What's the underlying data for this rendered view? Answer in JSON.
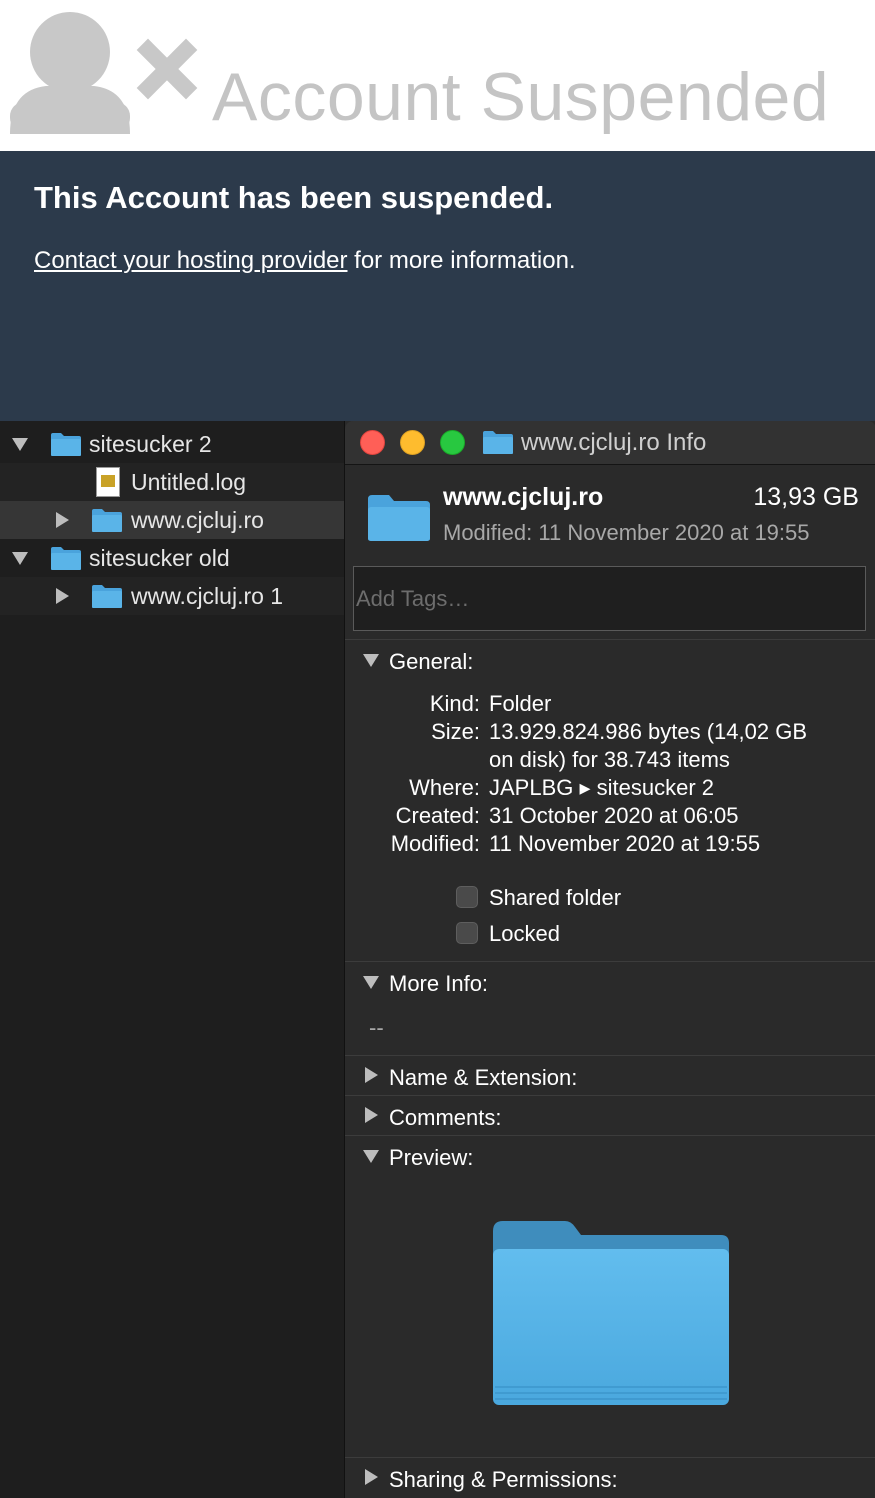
{
  "suspended": {
    "title": "Account Suspended",
    "heading": "This Account has been suspended.",
    "contact_link": "Contact your hosting provider",
    "contact_rest": " for more information.",
    "icon": "user-x-icon"
  },
  "finder": {
    "rows": [
      {
        "label": "sitesucker 2",
        "disclosure": "expanded",
        "icon": "folder-icon"
      },
      {
        "label": "Untitled.log",
        "disclosure": "none",
        "icon": "log-file-icon"
      },
      {
        "label": "www.cjcluj.ro",
        "disclosure": "collapsed",
        "icon": "folder-icon",
        "selected": true
      },
      {
        "label": "sitesucker old",
        "disclosure": "expanded",
        "icon": "folder-icon"
      },
      {
        "label": "www.cjcluj.ro 1",
        "disclosure": "collapsed",
        "icon": "folder-icon"
      }
    ]
  },
  "info_window": {
    "title": "www.cjcluj.ro Info",
    "name": "www.cjcluj.ro",
    "size": "13,93 GB",
    "modified": "Modified:  11 November 2020 at 19:55",
    "tags_placeholder": "Add Tags…",
    "sections": {
      "general": "General:",
      "more_info": "More Info:",
      "name_extension": "Name & Extension:",
      "comments": "Comments:",
      "preview": "Preview:",
      "sharing": "Sharing & Permissions:"
    },
    "general": {
      "kind_label": "Kind:",
      "kind_value": "Folder",
      "size_label": "Size:",
      "size_value_line1": "13.929.824.986 bytes (14,02 GB",
      "size_value_line2": "on disk) for 38.743 items",
      "where_label": "Where:",
      "where_value": "JAPLBG ▸ sitesucker 2",
      "created_label": "Created:",
      "created_value": "31 October 2020 at 06:05",
      "modified_label": "Modified:",
      "modified_value": "11 November 2020 at 19:55",
      "shared_folder": "Shared folder",
      "locked": "Locked"
    },
    "more_info_value": "--"
  },
  "colors": {
    "banner_panel": "#2c3a4b",
    "folder_blue": "#5ab4e8",
    "close": "#ff5f57",
    "minimize": "#febc2e",
    "zoom": "#28c840"
  }
}
